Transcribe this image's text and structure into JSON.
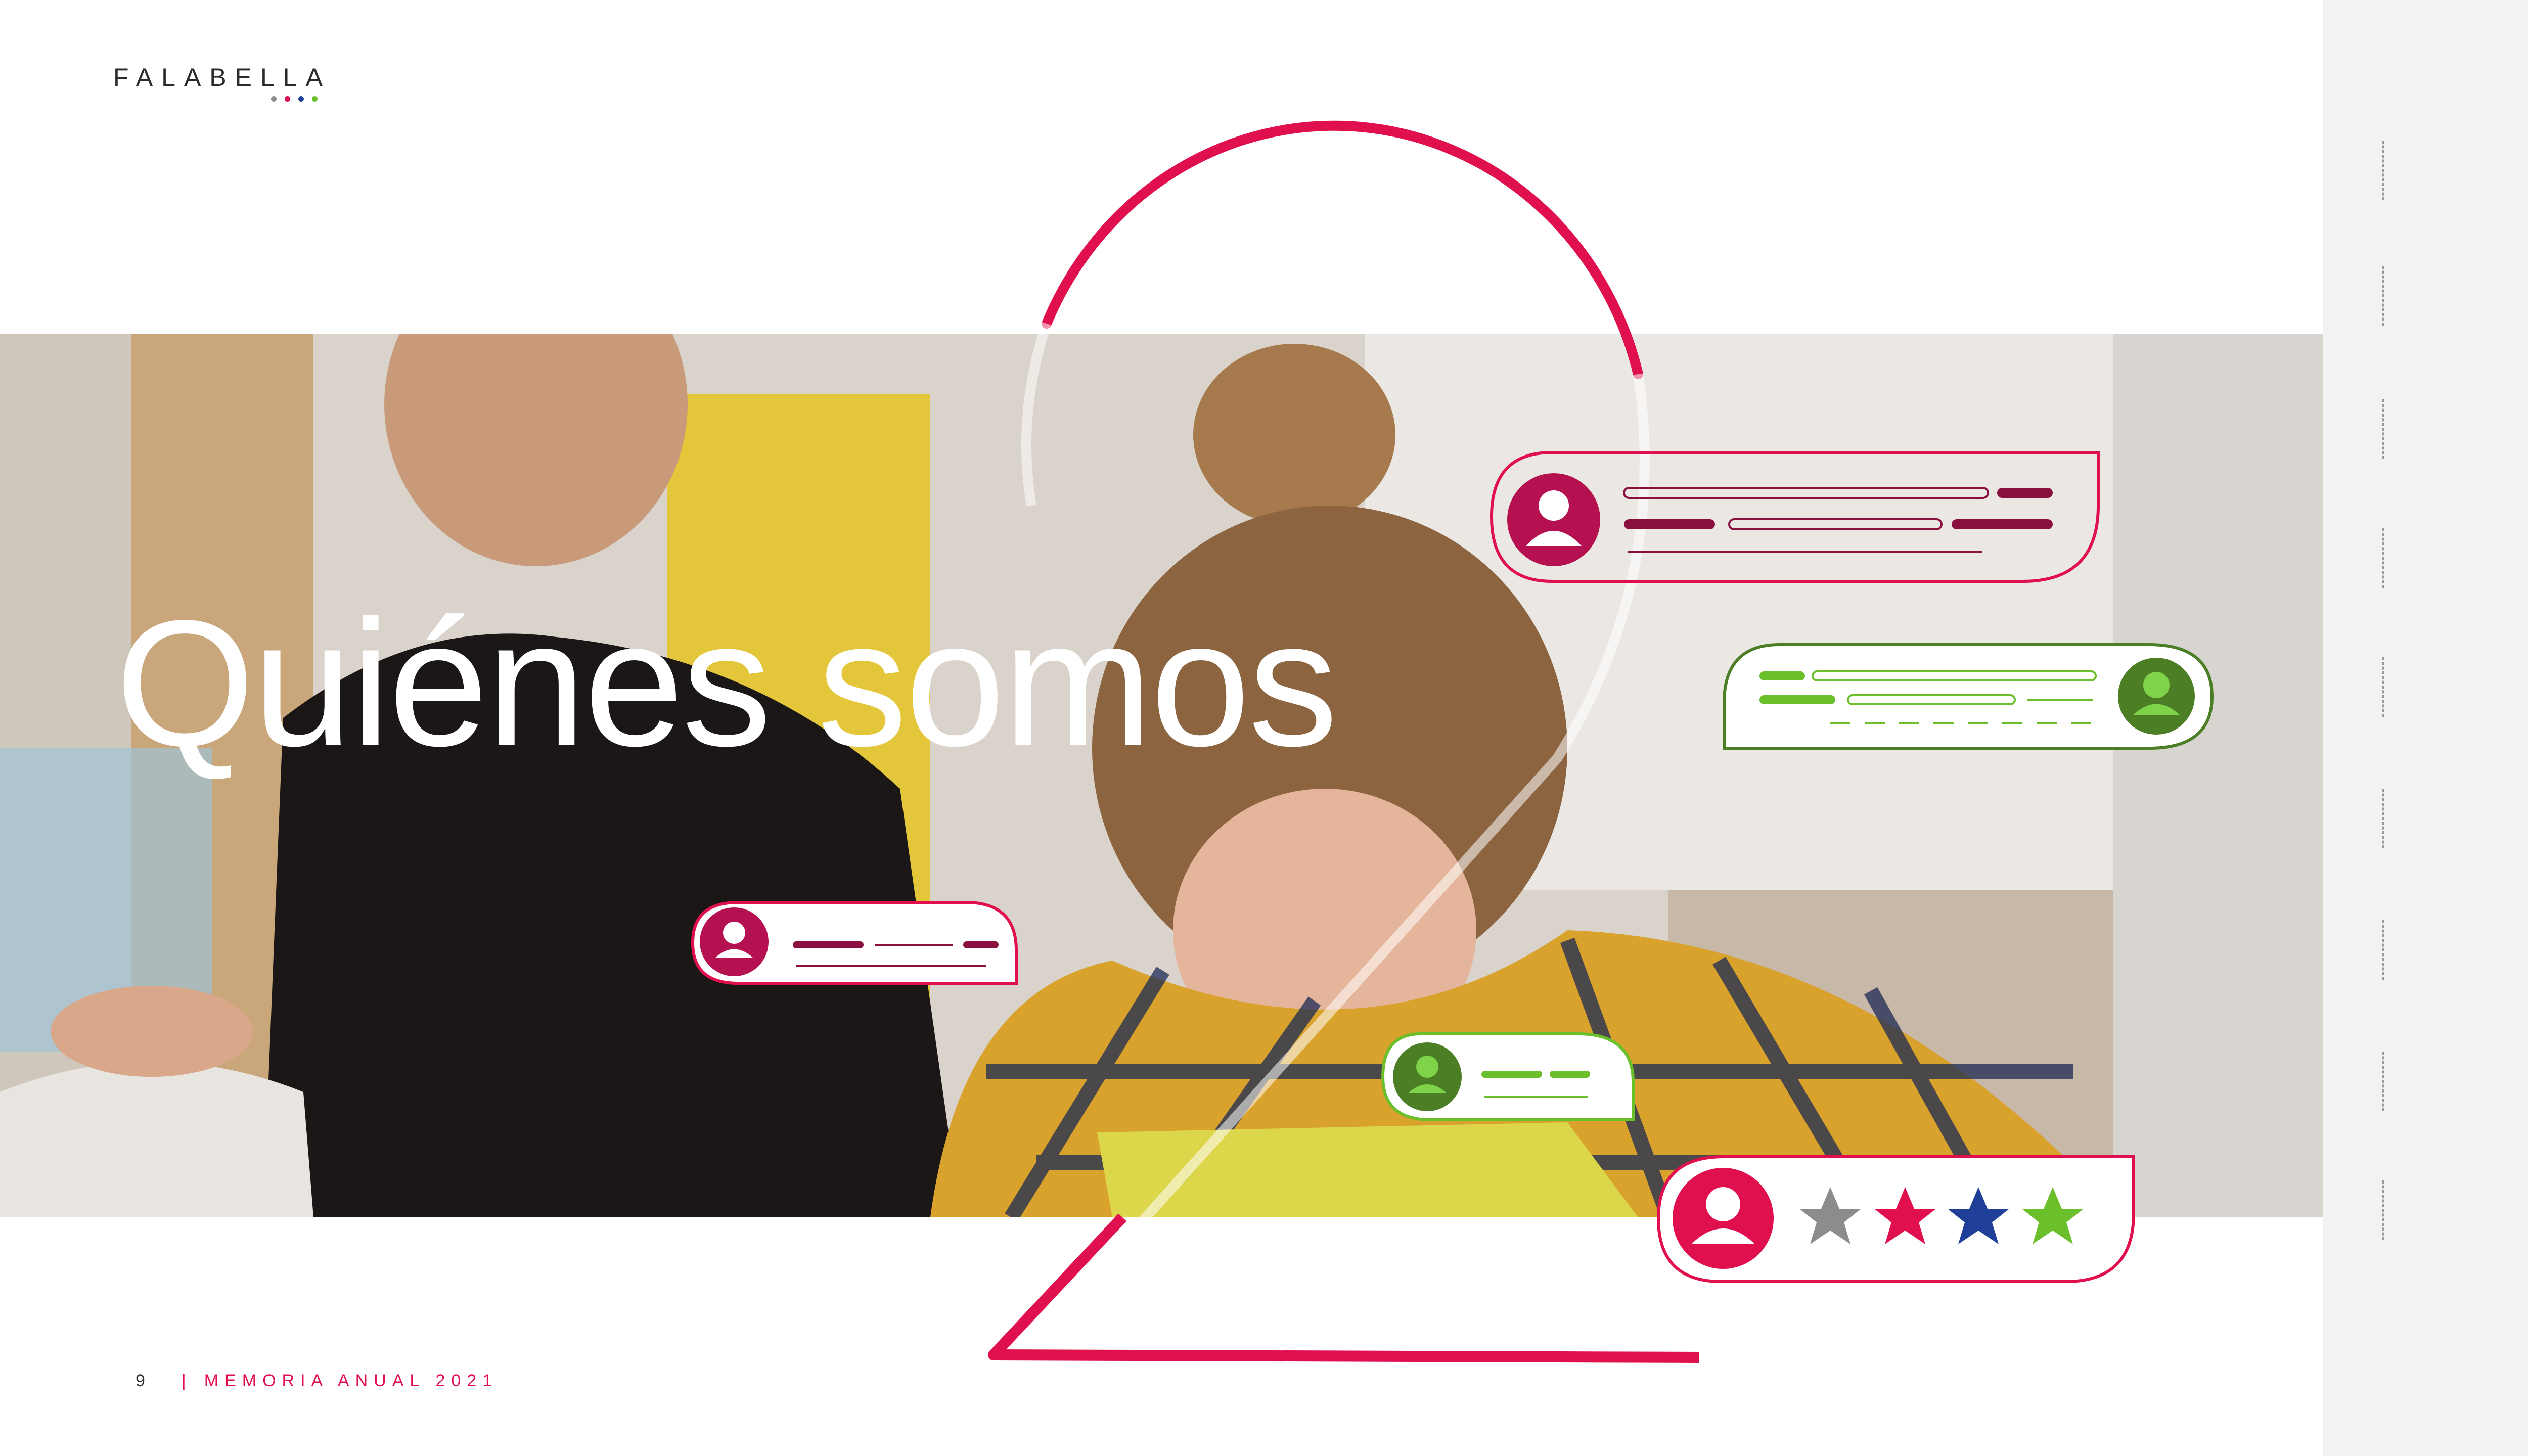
{
  "brand": {
    "name": "FALABELLA",
    "dot_colors": [
      "#8c8c8c",
      "#e0104f",
      "#1f3f99",
      "#6bbf2a"
    ]
  },
  "title": "Quiénes somos",
  "footer": {
    "page_number": "9",
    "separator": "|",
    "publication": "MEMORIA ANUAL 2021"
  },
  "colors": {
    "magenta": "#e0104f",
    "green": "#6bbf2a",
    "dark_green": "#4c7f25",
    "blue": "#1f3f99",
    "gray": "#8c8c8c",
    "wine": "#8a1040"
  },
  "rating_stars": {
    "filled": 4,
    "colors": [
      "#8c8c8c",
      "#e0104f",
      "#1f3f99",
      "#6bbf2a"
    ]
  },
  "icons": [
    "user-avatar-icon",
    "star-icon"
  ]
}
